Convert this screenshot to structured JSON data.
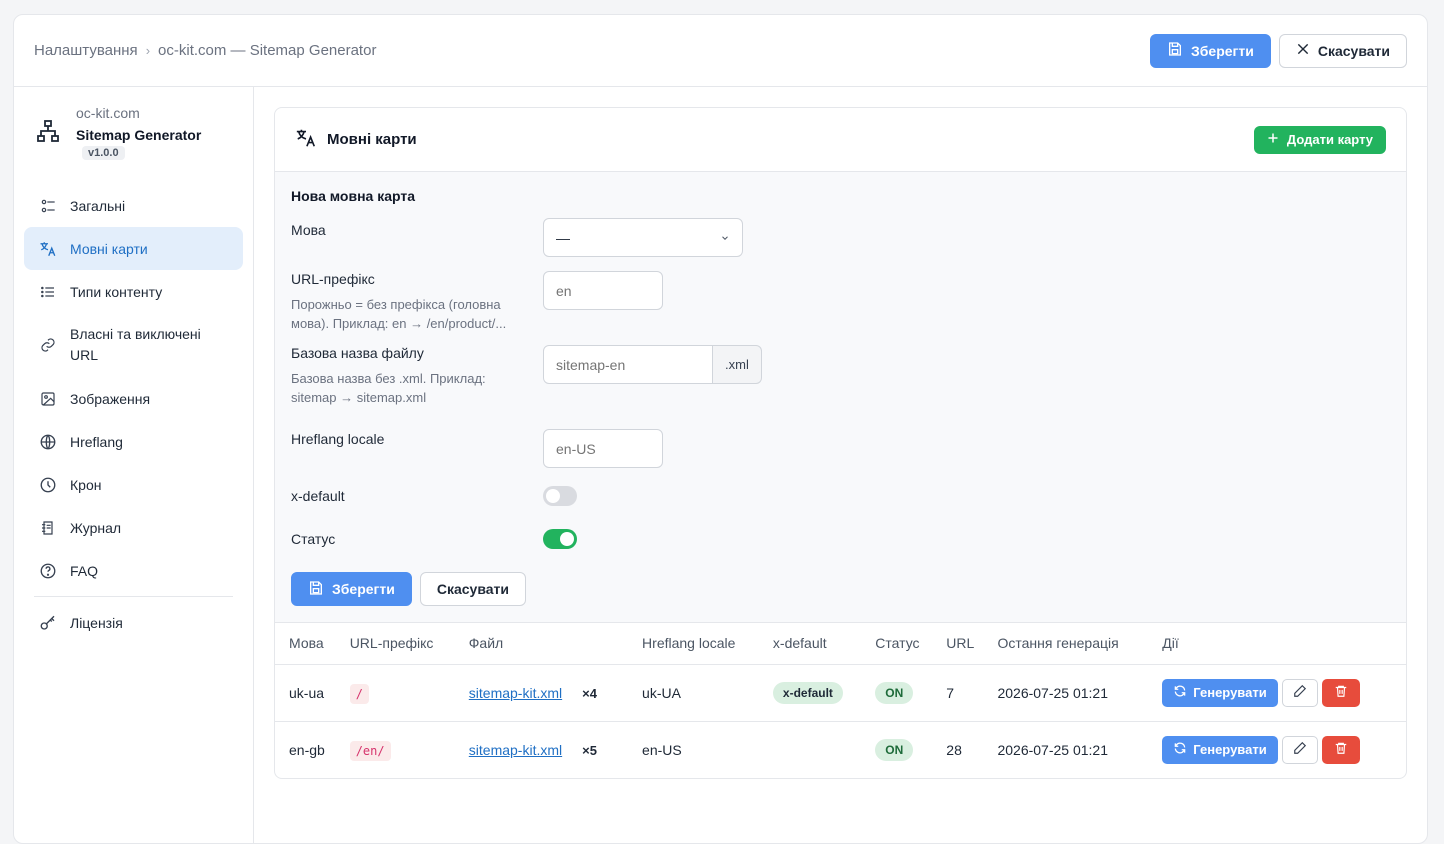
{
  "breadcrumb": {
    "root": "Налаштування",
    "separator": "›",
    "current": "oc-kit.com — Sitemap Generator"
  },
  "top_actions": {
    "save": "Зберегти",
    "cancel": "Скасувати"
  },
  "sidebar": {
    "domain": "oc-kit.com",
    "app_name": "Sitemap Generator",
    "version": "v1.0.0",
    "items": [
      {
        "label": "Загальні",
        "icon": "sliders-icon"
      },
      {
        "label": "Мовні карти",
        "icon": "translate-icon",
        "active": true
      },
      {
        "label": "Типи контенту",
        "icon": "list-icon"
      },
      {
        "label": "Власні та виключені URL",
        "icon": "link-icon"
      },
      {
        "label": "Зображення",
        "icon": "image-icon"
      },
      {
        "label": "Hreflang",
        "icon": "globe-icon"
      },
      {
        "label": "Крон",
        "icon": "clock-icon"
      },
      {
        "label": "Журнал",
        "icon": "journal-icon"
      },
      {
        "label": "FAQ",
        "icon": "question-icon"
      },
      {
        "label": "Ліцензія",
        "icon": "key-icon"
      }
    ]
  },
  "card": {
    "title": "Мовні карти",
    "add_button": "Додати карту",
    "form": {
      "title": "Нова мовна карта",
      "language": {
        "label": "Мова",
        "value": "—"
      },
      "url_prefix": {
        "label": "URL-префікс",
        "help": "Порожньо = без префікса (головна мова). Приклад: en → /en/product/...",
        "placeholder": "en"
      },
      "file_base": {
        "label": "Базова назва файлу",
        "help": "Базова назва без .xml. Приклад: sitemap → sitemap.xml",
        "placeholder": "sitemap-en",
        "suffix": ".xml"
      },
      "hreflang": {
        "label": "Hreflang locale",
        "placeholder": "en-US"
      },
      "x_default": {
        "label": "x-default",
        "on": false
      },
      "status": {
        "label": "Статус",
        "on": true
      },
      "save": "Зберегти",
      "cancel": "Скасувати"
    },
    "table": {
      "headers": [
        "Мова",
        "URL-префікс",
        "Файл",
        "Hreflang locale",
        "x-default",
        "Статус",
        "URL",
        "Остання генерація",
        "Дії"
      ],
      "generate_label": "Генерувати",
      "rows": [
        {
          "lang": "uk-ua",
          "prefix": "/",
          "file": "sitemap-kit.xml",
          "mult": "×4",
          "hreflang": "uk-UA",
          "xdefault": "x-default",
          "status": "ON",
          "urls": "7",
          "last": "2026-07-25 01:21"
        },
        {
          "lang": "en-gb",
          "prefix": "/en/",
          "file": "sitemap-kit.xml",
          "mult": "×5",
          "hreflang": "en-US",
          "xdefault": "",
          "status": "ON",
          "urls": "28",
          "last": "2026-07-25 01:21"
        }
      ]
    }
  },
  "colors": {
    "primary": "#4f8ff0",
    "success": "#22b35e",
    "danger": "#e74c3c",
    "active_bg": "#e3eefb",
    "active_text": "#1f6fc4"
  }
}
